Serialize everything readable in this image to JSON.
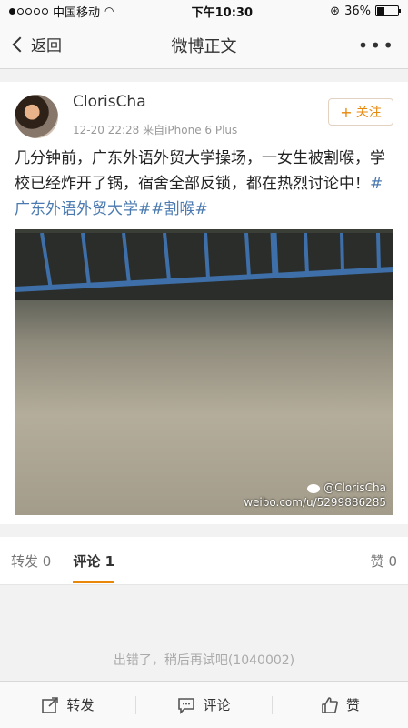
{
  "status": {
    "carrier": "中国移动",
    "time": "下午10:30",
    "battery": "36%"
  },
  "nav": {
    "back_label": "返回",
    "title": "微博正文",
    "more_label": "•••"
  },
  "post": {
    "username": "ClorisCha",
    "meta": "12-20 22:28  来自iPhone 6 Plus",
    "follow_label": "关注",
    "text_main": "几分钟前，广东外语外贸大学操场，一女生被割喉，学校已经炸开了锅，宿舍全部反锁，都在热烈讨论中！",
    "hashtag1": "#广东外语外贸大学#",
    "hashtag2": "#割喉#",
    "watermark_user": "@ClorisCha",
    "watermark_url": "weibo.com/u/5299886285"
  },
  "tabs": {
    "repost_label": "转发",
    "repost_count": "0",
    "comment_label": "评论",
    "comment_count": "1",
    "like_label": "赞",
    "like_count": "0"
  },
  "error_text": "出错了，稍后再试吧(1040002)",
  "toolbar": {
    "repost": "转发",
    "comment": "评论",
    "like": "赞"
  }
}
